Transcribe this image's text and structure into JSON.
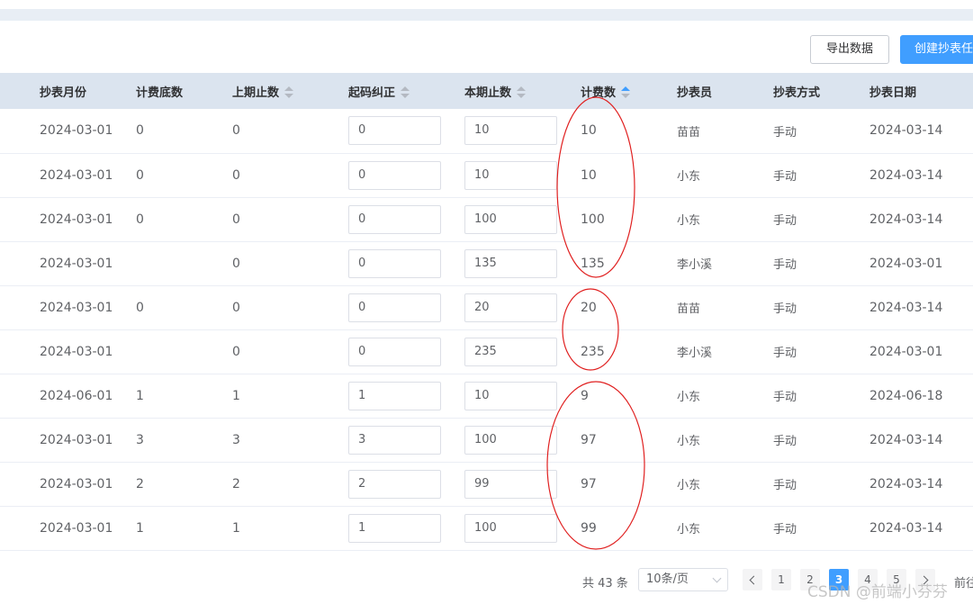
{
  "toolbar": {
    "export_label": "导出数据",
    "create_label": "创建抄表任务"
  },
  "table": {
    "headers": [
      "抄表月份",
      "计费底数",
      "上期止数",
      "起码纠正",
      "本期止数",
      "计费数",
      "抄表员",
      "抄表方式",
      "抄表日期"
    ],
    "sortable_columns": [
      "上期止数",
      "起码纠正",
      "本期止数",
      "计费数"
    ],
    "active_sort": "计费数",
    "rows": [
      {
        "month": "2024-03-01",
        "base": "0",
        "prev": "0",
        "correct": "0",
        "curr": "10",
        "billed": "10",
        "reader": "苗苗",
        "method": "手动",
        "date": "2024-03-14"
      },
      {
        "month": "2024-03-01",
        "base": "0",
        "prev": "0",
        "correct": "0",
        "curr": "10",
        "billed": "10",
        "reader": "小东",
        "method": "手动",
        "date": "2024-03-14"
      },
      {
        "month": "2024-03-01",
        "base": "0",
        "prev": "0",
        "correct": "0",
        "curr": "100",
        "billed": "100",
        "reader": "小东",
        "method": "手动",
        "date": "2024-03-14"
      },
      {
        "month": "2024-03-01",
        "base": "",
        "prev": "0",
        "correct": "0",
        "curr": "135",
        "billed": "135",
        "reader": "李小溪",
        "method": "手动",
        "date": "2024-03-01"
      },
      {
        "month": "2024-03-01",
        "base": "0",
        "prev": "0",
        "correct": "0",
        "curr": "20",
        "billed": "20",
        "reader": "苗苗",
        "method": "手动",
        "date": "2024-03-14"
      },
      {
        "month": "2024-03-01",
        "base": "",
        "prev": "0",
        "correct": "0",
        "curr": "235",
        "billed": "235",
        "reader": "李小溪",
        "method": "手动",
        "date": "2024-03-01"
      },
      {
        "month": "2024-06-01",
        "base": "1",
        "prev": "1",
        "correct": "1",
        "curr": "10",
        "billed": "9",
        "reader": "小东",
        "method": "手动",
        "date": "2024-06-18"
      },
      {
        "month": "2024-03-01",
        "base": "3",
        "prev": "3",
        "correct": "3",
        "curr": "100",
        "billed": "97",
        "reader": "小东",
        "method": "手动",
        "date": "2024-03-14"
      },
      {
        "month": "2024-03-01",
        "base": "2",
        "prev": "2",
        "correct": "2",
        "curr": "99",
        "billed": "97",
        "reader": "小东",
        "method": "手动",
        "date": "2024-03-14"
      },
      {
        "month": "2024-03-01",
        "base": "1",
        "prev": "1",
        "correct": "1",
        "curr": "100",
        "billed": "99",
        "reader": "小东",
        "method": "手动",
        "date": "2024-03-14"
      }
    ]
  },
  "pagination": {
    "total_text": "共 43 条",
    "page_size": "10条/页",
    "pages": [
      "1",
      "2",
      "3",
      "4",
      "5"
    ],
    "current_page": "3",
    "goto_text": "前往"
  },
  "annotation": {
    "color": "#e02020"
  },
  "watermark": "CSDN @前端小芬芬",
  "colors": {
    "accent": "#409eff",
    "header_bg": "#dbe4ef"
  }
}
